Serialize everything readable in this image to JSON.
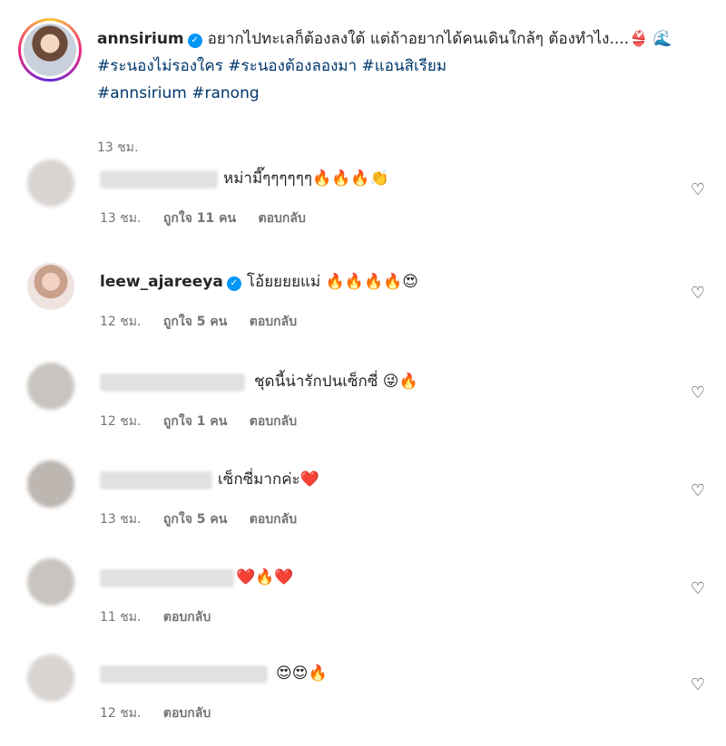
{
  "post": {
    "username": "annsirium",
    "caption_text": "อยากไปทะเลก็ต้องลงใต้ แต่ถ้าอยากได้คนเดินใกล้ๆ ต้องทำไง....",
    "caption_emoji": "👙 🌊",
    "hashtags": [
      "#ระนองไม่รองใคร",
      "#ระนองต้องลองมา",
      "#แอนสิเรียม",
      "#annsirium",
      "#ranong"
    ],
    "time": "13 ชม."
  },
  "labels": {
    "reply": "ตอบกลับ"
  },
  "comments": [
    {
      "username": "",
      "text": "หม่ามี๊ๆๆๆๆๆๆ🔥🔥🔥👏",
      "time": "13 ชม.",
      "likes": "ถูกใจ 11 คน"
    },
    {
      "username": "leew_ajareeya",
      "text": "โอ้ยยยยแม่ 🔥🔥🔥🔥😍",
      "time": "12 ชม.",
      "likes": "ถูกใจ 5 คน"
    },
    {
      "username": "",
      "text": "ชุดนี้น่ารักปนเซ็กซี่ 😜🔥",
      "time": "12 ชม.",
      "likes": "ถูกใจ 1 คน"
    },
    {
      "username": "",
      "text": "เซ็กซี่มากค่ะ❤️",
      "time": "13 ชม.",
      "likes": "ถูกใจ 5 คน"
    },
    {
      "username": "",
      "text": "❤️🔥❤️",
      "time": "11 ชม.",
      "likes": ""
    },
    {
      "username": "",
      "text": "😍😍🔥",
      "time": "12 ชม.",
      "likes": ""
    }
  ],
  "icons": {
    "verified": "verified-badge-icon",
    "like": "heart-outline-icon"
  },
  "colors": {
    "hashtag": "#00376b",
    "verified": "#0095f6",
    "meta": "#737373"
  }
}
